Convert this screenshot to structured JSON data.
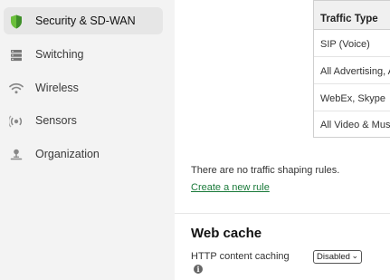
{
  "sidebar": {
    "items": [
      {
        "label": "Security & SD-WAN",
        "icon": "shield-icon",
        "active": true
      },
      {
        "label": "Switching",
        "icon": "switch-icon",
        "active": false
      },
      {
        "label": "Wireless",
        "icon": "wifi-icon",
        "active": false
      },
      {
        "label": "Sensors",
        "icon": "sensor-icon",
        "active": false
      },
      {
        "label": "Organization",
        "icon": "organization-icon",
        "active": false
      }
    ],
    "accent_color": "#6bbf3b"
  },
  "traffic_table": {
    "header": "Traffic Type",
    "rows": [
      "SIP (Voice)",
      "All Advertising, A",
      "WebEx, Skype",
      "All Video & Music"
    ]
  },
  "shaping": {
    "empty_message": "There are no traffic shaping rules.",
    "create_link": "Create a new rule"
  },
  "web_cache": {
    "title": "Web cache",
    "field_label": "HTTP content caching",
    "select_value": "Disabled"
  }
}
